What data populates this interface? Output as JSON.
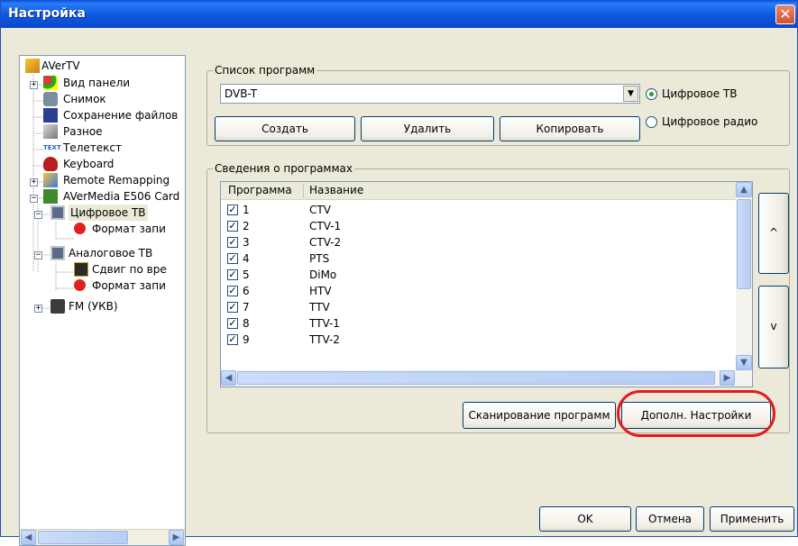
{
  "window": {
    "title": "Настройка",
    "close_symbol": "✕"
  },
  "tree": {
    "items": [
      {
        "label": "AVerTV",
        "icon": "app-icon"
      },
      {
        "label": "Вид панели",
        "icon": "view-panel-icon"
      },
      {
        "label": "Снимок",
        "icon": "camera-icon"
      },
      {
        "label": "Сохранение файлов",
        "icon": "save-icon"
      },
      {
        "label": "Разное",
        "icon": "wrench-icon"
      },
      {
        "label": "Телетекст",
        "icon": "teletext-icon"
      },
      {
        "label": "Keyboard",
        "icon": "keyboard-icon"
      },
      {
        "label": "Remote Remapping",
        "icon": "remote-icon"
      },
      {
        "label": "AVerMedia E506 Card",
        "icon": "card-icon"
      },
      {
        "label": "Цифровое ТВ",
        "icon": "tv-icon"
      },
      {
        "label": "Формат запи",
        "icon": "record-icon"
      },
      {
        "label": "Аналоговое ТВ",
        "icon": "tv-icon"
      },
      {
        "label": "Сдвиг по вре",
        "icon": "timeshift-icon"
      },
      {
        "label": "Формат запи",
        "icon": "record-icon"
      },
      {
        "label": "FM (УКВ)",
        "icon": "radio-icon"
      }
    ]
  },
  "program_list": {
    "legend": "Список программ",
    "selected": "DVB-T",
    "buttons": {
      "create": "Создать",
      "delete": "Удалить",
      "copy": "Копировать"
    },
    "radio_digital_tv": "Цифровое ТВ",
    "radio_digital_radio": "Цифровое радио",
    "selected_radio": "digital_tv"
  },
  "program_info": {
    "legend": "Сведения о программах",
    "columns": [
      "Программа",
      "Название"
    ],
    "rows": [
      {
        "num": "1",
        "name": "CTV",
        "checked": true
      },
      {
        "num": "2",
        "name": "CTV-1",
        "checked": true
      },
      {
        "num": "3",
        "name": "CTV-2",
        "checked": true
      },
      {
        "num": "4",
        "name": "PTS",
        "checked": true
      },
      {
        "num": "5",
        "name": "DiMo",
        "checked": true
      },
      {
        "num": "6",
        "name": "HTV",
        "checked": true
      },
      {
        "num": "7",
        "name": "TTV",
        "checked": true
      },
      {
        "num": "8",
        "name": "TTV-1",
        "checked": true
      },
      {
        "num": "9",
        "name": "TTV-2",
        "checked": true
      }
    ],
    "up_label": "^",
    "down_label": "v",
    "scan_button": "Сканирование программ",
    "advanced_button": "Дополн. Настройки"
  },
  "footer": {
    "ok": "OK",
    "cancel": "Отмена",
    "apply": "Применить"
  },
  "colors": {
    "titlebar": "#0A5DF0",
    "window_bg": "#ECE9D8",
    "highlight": "#E21A1A"
  }
}
